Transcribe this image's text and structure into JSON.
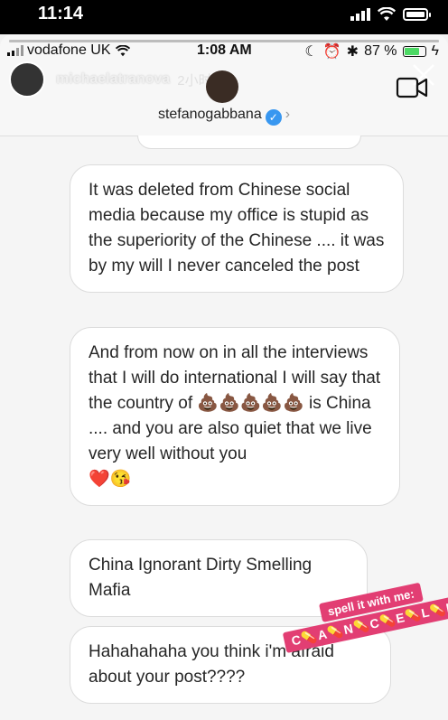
{
  "outer_status": {
    "time": "11:14"
  },
  "inner_status": {
    "carrier": "vodafone UK",
    "time": "1:08 AM",
    "battery": "87 %"
  },
  "story": {
    "username": "michaelatranova",
    "age": "2小时"
  },
  "chat": {
    "username": "stefanogabbana"
  },
  "messages": [
    {
      "text": "It was deleted from Chinese social media because my office is stupid as the superiority of the Chinese .... it was by my will I never canceled the post"
    },
    {
      "text": "And from now on in all the interviews that I will do international I will say that the country of 💩💩💩💩💩 is China .... and you are also quiet that we live very well without you",
      "emoji_line": "❤️😘"
    },
    {
      "text": "China Ignorant Dirty Smelling Mafia"
    },
    {
      "text": "Hahahahaha you think i'm afraid about your post????"
    }
  ],
  "sticker": {
    "title": "spell it with me:",
    "word": "C💊A💊N💊C💊E💊L💊L💊E💊D"
  },
  "colors": {
    "sticker": "#e23e73",
    "verified": "#3897f0"
  },
  "icons": [
    "signal-icon",
    "wifi-icon",
    "battery-icon",
    "close-icon",
    "video-call-icon",
    "verified-icon"
  ]
}
